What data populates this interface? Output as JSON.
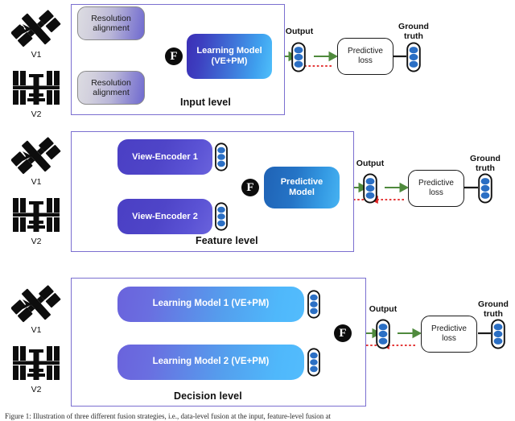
{
  "figure": {
    "caption": "Figure 1: Illustration of three different fusion strategies, i.e., data-level fusion at the input, feature-level fusion at"
  },
  "views": [
    {
      "id": "v1",
      "label": "V1",
      "icon": "satellite-icon"
    },
    {
      "id": "v2",
      "label": "V2",
      "icon": "space-station-icon"
    }
  ],
  "panels": [
    {
      "id": "input-level",
      "label": "Input level",
      "blocks": [
        {
          "name": "resolution-alignment-1",
          "text": "Resolution\nalignment"
        },
        {
          "name": "resolution-alignment-2",
          "text": "Resolution\nalignment"
        },
        {
          "name": "learning-model",
          "text": "Learning Model\n(VE+PM)"
        }
      ],
      "fusion_symbol": "F"
    },
    {
      "id": "feature-level",
      "label": "Feature level",
      "blocks": [
        {
          "name": "view-encoder-1",
          "text": "View-Encoder 1"
        },
        {
          "name": "view-encoder-2",
          "text": "View-Encoder 2"
        },
        {
          "name": "predictive-model",
          "text": "Predictive\nModel"
        }
      ],
      "fusion_symbol": "F"
    },
    {
      "id": "decision-level",
      "label": "Decision level",
      "blocks": [
        {
          "name": "learning-model-1",
          "text": "Learning Model 1 (VE+PM)"
        },
        {
          "name": "learning-model-2",
          "text": "Learning Model 2 (VE+PM)"
        }
      ],
      "fusion_symbol": "F"
    }
  ],
  "common": {
    "output_label": "Output",
    "ground_truth_label": "Ground\ntruth",
    "predictive_loss_label": "Predictive\nloss",
    "fusion_symbol": "F"
  },
  "colors": {
    "panel_border": "#7b6fd0",
    "forward_arrow": "#4f8a3d",
    "backward_arrow": "#e02020",
    "neuron_fill": "#2b6fc4",
    "fusion_circle": "#0c0c0c"
  }
}
